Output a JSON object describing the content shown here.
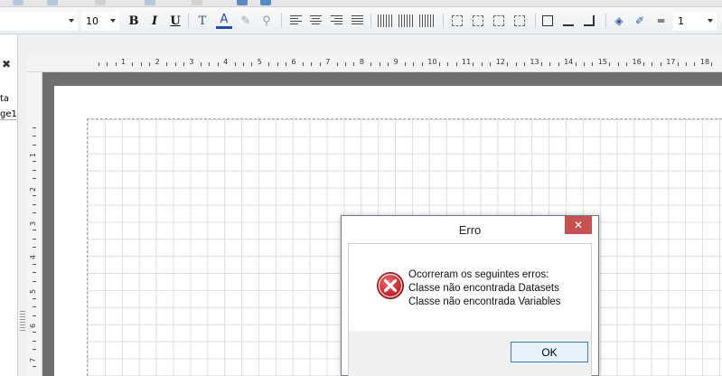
{
  "toolbar": {
    "font_size": "10",
    "bold_label": "B",
    "italic_label": "I",
    "underline_label": "U",
    "text_style_label": "T",
    "font_color_label": "A",
    "line_width": "1"
  },
  "left_panel": {
    "close_label": "✖",
    "item_1": "ta",
    "item_2": "ge1"
  },
  "ruler": {
    "horizontal": [
      "1",
      "2",
      "3",
      "4",
      "5",
      "6",
      "7",
      "8",
      "9",
      "10",
      "11",
      "12",
      "13",
      "14",
      "15",
      "16",
      "17",
      "18"
    ],
    "vertical": [
      "1",
      "2",
      "3",
      "4",
      "5",
      "6",
      "7"
    ]
  },
  "dialog": {
    "title": "Erro",
    "close_label": "✕",
    "message_line_1": "Ocorreram os seguintes erros:",
    "message_line_2": "Classe não encontrada Datasets",
    "message_line_3": "Classe não encontrada Variables",
    "ok_label": "OK"
  },
  "colors": {
    "close_button": "#c75050",
    "error_icon": "#d9262b",
    "ok_border": "#3c7fb1"
  }
}
